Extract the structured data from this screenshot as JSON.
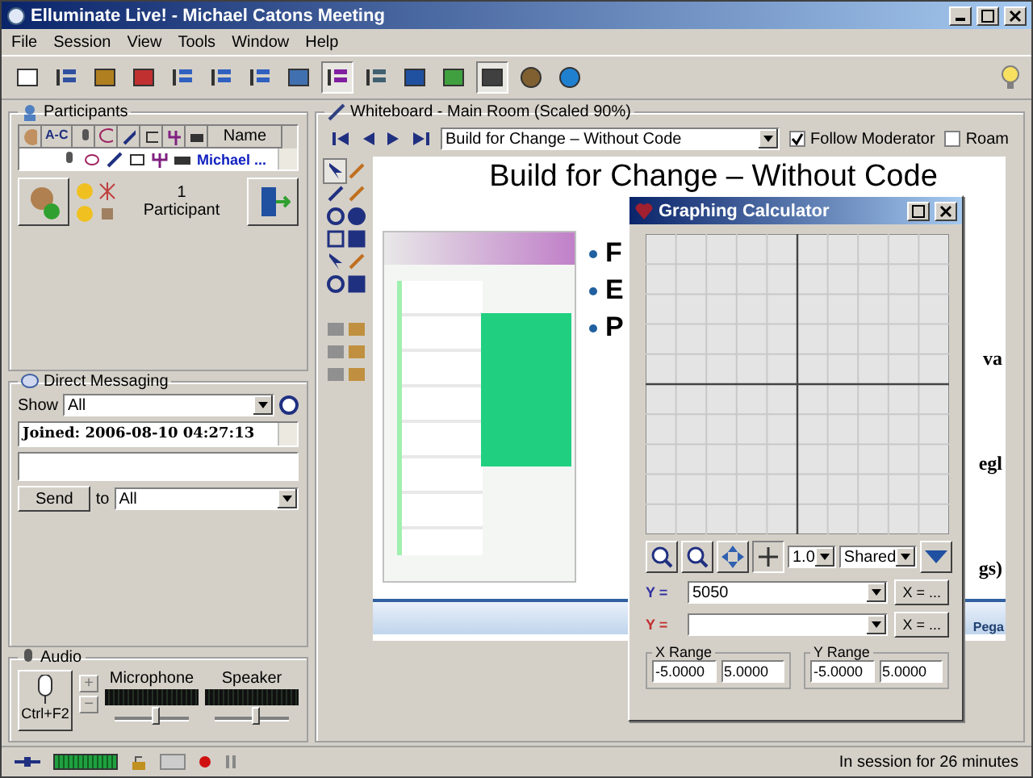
{
  "window": {
    "title": "Elluminate Live! - Michael Catons Meeting"
  },
  "menu": [
    "File",
    "Session",
    "View",
    "Tools",
    "Window",
    "Help"
  ],
  "participants": {
    "title": "Participants",
    "column_headers": [
      "A-C",
      "Name"
    ],
    "rows": [
      {
        "name": "Michael ..."
      }
    ],
    "count": "1",
    "count_label": "Participant"
  },
  "direct_messaging": {
    "title": "Direct Messaging",
    "show_label": "Show",
    "show_value": "All",
    "log": [
      "Joined: 2006-08-10 04:27:13"
    ],
    "send": "Send",
    "to_label": "to",
    "to_value": "All"
  },
  "audio": {
    "title": "Audio",
    "talk_key": "Ctrl+F2",
    "plus": "+",
    "minus": "−",
    "channels": [
      {
        "label": "Microphone",
        "level": 0.55
      },
      {
        "label": "Speaker",
        "level": 0.55
      }
    ]
  },
  "whiteboard": {
    "title": "Whiteboard - Main Room (Scaled 90%)",
    "page": "Build for Change – Without Code",
    "follow_moderator": {
      "label": "Follow Moderator",
      "checked": true
    },
    "roam": {
      "label": "Roam",
      "checked": false
    },
    "slide": {
      "heading": "Build for Change – Without Code",
      "bullets": [
        "F",
        "E",
        "P"
      ],
      "fragments": [
        "va",
        "egl",
        "gs)"
      ],
      "logo": "Pega"
    }
  },
  "calculator": {
    "title": "Graphing Calculator",
    "zoom_value": "1.0",
    "mode_value": "Shared",
    "equations": [
      {
        "label": "Y =",
        "value": "5050",
        "color": "#3030a0",
        "button": "X = ..."
      },
      {
        "label": "Y =",
        "color": "#c03030",
        "button": "X = ..."
      }
    ],
    "x_range": {
      "label": "X Range",
      "min": "-5.0000",
      "max": "5.0000"
    },
    "y_range": {
      "label": "Y Range",
      "min": "-5.0000",
      "max": "5.0000"
    }
  },
  "status_bar": {
    "text": "In session for 26 minutes"
  }
}
